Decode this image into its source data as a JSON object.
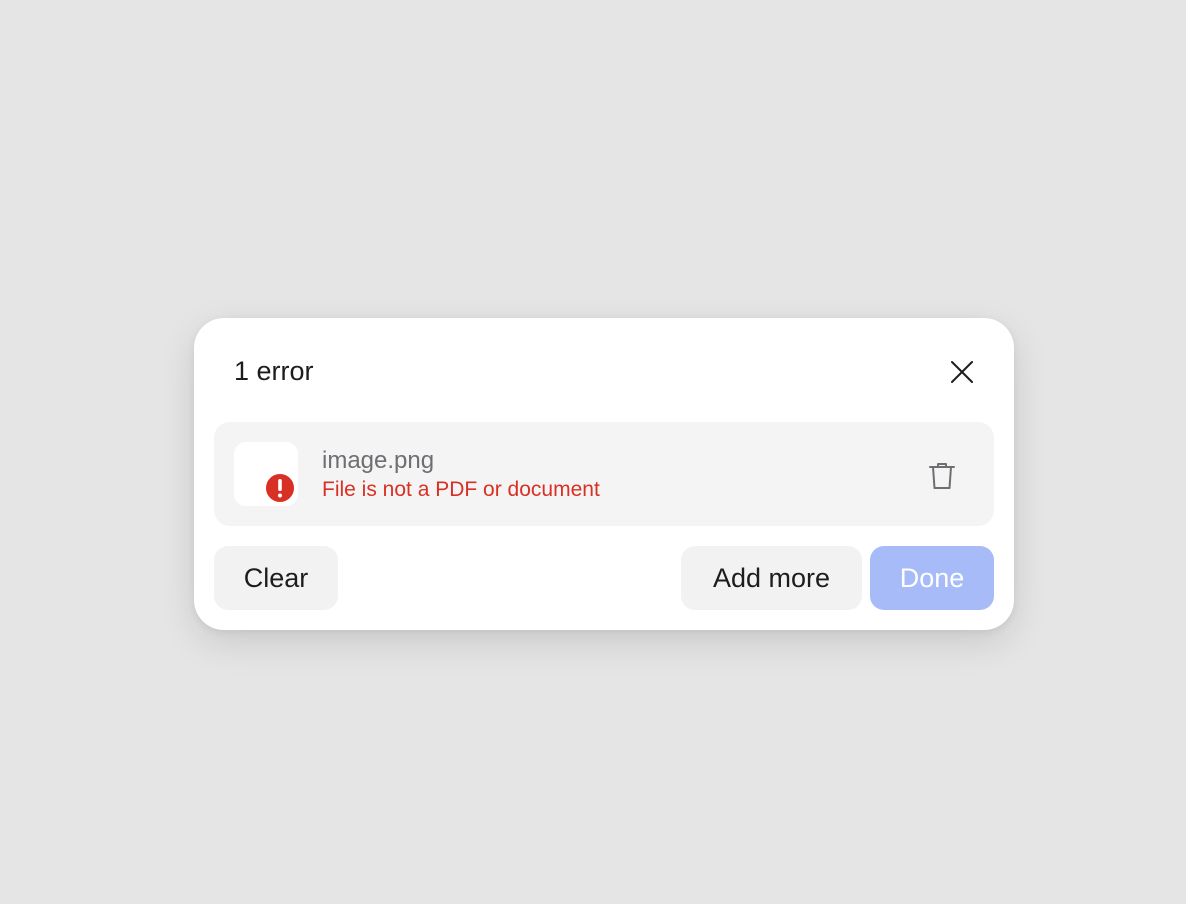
{
  "dialog": {
    "title": "1 error",
    "close_icon": "close-icon"
  },
  "file": {
    "name": "image.png",
    "error": "File is not a PDF or document",
    "thumbnail_icon": "error-icon",
    "delete_icon": "trash-icon"
  },
  "actions": {
    "clear_label": "Clear",
    "add_more_label": "Add more",
    "done_label": "Done"
  },
  "colors": {
    "background": "#e5e5e5",
    "dialog": "#ffffff",
    "error": "#d93025",
    "done_disabled": "#a6bbf8",
    "secondary_button": "#f2f2f2"
  }
}
